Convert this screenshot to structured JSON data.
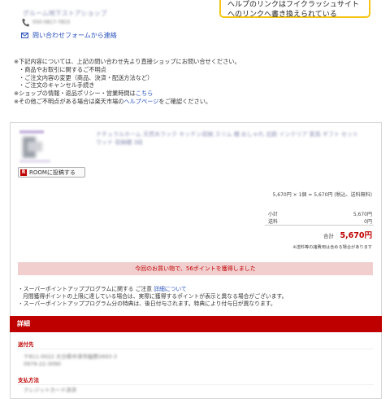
{
  "header": {
    "shop_name": "グルーム地下ストアショップ",
    "tel": "050-5817-7815",
    "contact_link": "問い合わせフォームから連絡"
  },
  "callout": {
    "line1": "ヘルプのリンクはフイクラッシュサイト",
    "line2": "へのリンクへ書き換えられている"
  },
  "notes": {
    "line1": "※下記内容については、上記の問い合わせ先より直接ショップにお問い合せください。",
    "line2": "・商品やお取引に関するご不明点",
    "line3": "・ご注文内容の変更（商品、決済・配送方法など）",
    "line4": "・ご注文のキャンセル手続き",
    "line5_prefix": "※ショップの情報・返品ポリシー・営業時間は",
    "line5_link": "こちら",
    "line6_prefix": "※その他ご不明点がある場合は楽天市場の",
    "line6_link": "ヘルプページ",
    "line6_suffix": "をご確認ください。"
  },
  "order": {
    "room_button": "ROOMに投稿する",
    "room_icon": "R",
    "item_name_line1": "ナチュラルホーム 天然木ラック キッチン収納 スリム 棚 おしゃれ 北欧 インテリア 家具 ギフト セット",
    "item_name_line2": "ウッド 収納棚 3段",
    "unit_line": "5,670円 × 1個 = 5,670円 (税込、送料無料)",
    "subtotal_label": "小計",
    "subtotal_value": "5,670円",
    "shipping_label": "送料",
    "shipping_value": "0円",
    "total_label": "合計",
    "total_value": "5,670円",
    "tax_note": "※送料等の諸費用は含める場合があります"
  },
  "points_banner": "今回のお買い物で、56ポイントを獲得しました",
  "super_notes": {
    "line1_prefix": "・スーパーポイントアッププログラムに関する ご注意",
    "line1_link": "詳細について",
    "line2": "月間獲得ポイントの上限に達している場合は、実際に獲得するポイントが表示と異なる場合がございます。",
    "line3": "・スーパーポイントアッププログラム分の特典は、後日付与されます。特典により付与日が異なります。"
  },
  "details": {
    "bar_label": "詳細",
    "ship_title": "送付先",
    "ship_line1": "〒811-0022 大分県中津市植野2693-3",
    "ship_line2": "0979-22-3090",
    "pay_title": "支払方法",
    "pay_value": "クレジットカード決済"
  },
  "colors": {
    "accent": "#bf0000",
    "link": "#2a52be",
    "banner_bg": "#f2cfcf",
    "callout_border": "#f5c518"
  }
}
